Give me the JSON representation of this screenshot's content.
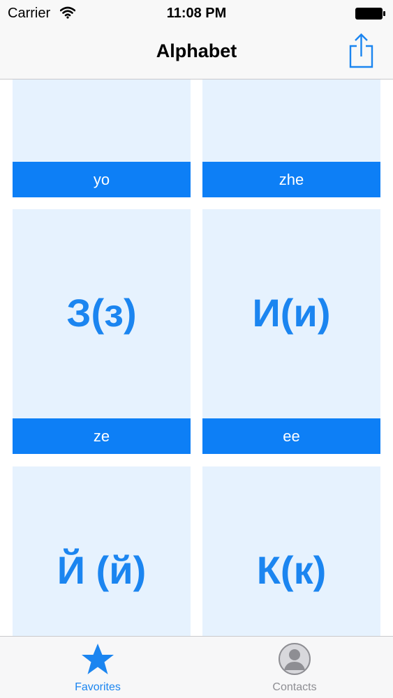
{
  "status_bar": {
    "carrier": "Carrier",
    "time": "11:08 PM",
    "wifi_icon": "wifi-icon",
    "battery_icon": "battery-icon"
  },
  "nav": {
    "title": "Alphabet",
    "share_icon": "share-icon"
  },
  "cards": [
    {
      "letter": "",
      "label": "yo"
    },
    {
      "letter": "",
      "label": "zhe"
    },
    {
      "letter": "З(з)",
      "label": "ze"
    },
    {
      "letter": "И(и)",
      "label": "ee"
    },
    {
      "letter": "Й (й)",
      "label": ""
    },
    {
      "letter": "К(к)",
      "label": ""
    }
  ],
  "tabs": [
    {
      "label": "Favorites",
      "icon": "star-icon",
      "selected": true
    },
    {
      "label": "Contacts",
      "icon": "contact-icon",
      "selected": false
    }
  ],
  "colors": {
    "accent": "#0d7ff6",
    "card_background": "#e6f2fe",
    "letter": "#1b85f0",
    "tab_inactive": "#8e8e93"
  }
}
